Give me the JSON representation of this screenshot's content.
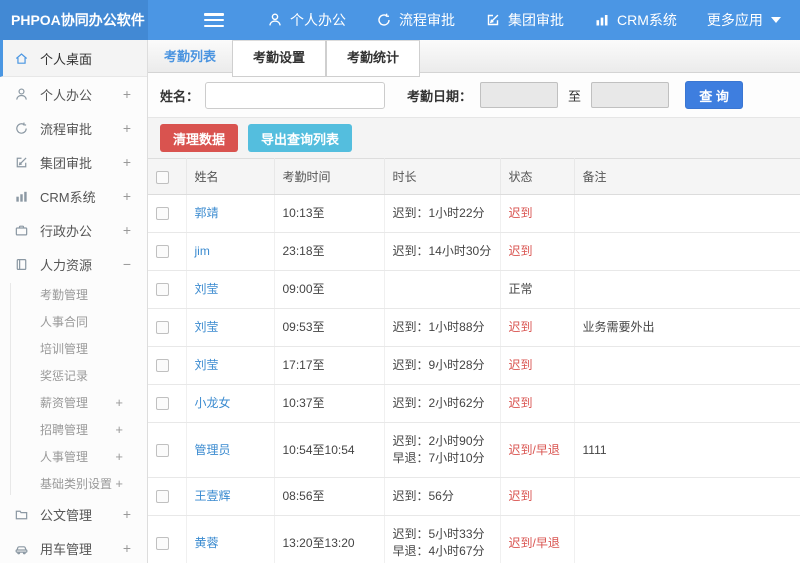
{
  "topbar": {
    "logo": "PHPOA协同办公软件",
    "nav": [
      {
        "label": "个人办公",
        "icon": "user-icon"
      },
      {
        "label": "流程审批",
        "icon": "refresh-icon"
      },
      {
        "label": "集团审批",
        "icon": "edit-icon"
      },
      {
        "label": "CRM系统",
        "icon": "bar-chart-icon"
      },
      {
        "label": "更多应用",
        "icon": "caret-down-icon"
      }
    ]
  },
  "sidebar": {
    "items": [
      {
        "label": "个人桌面",
        "icon": "home-icon",
        "active": true
      },
      {
        "label": "个人办公",
        "icon": "user-icon",
        "expand": "+"
      },
      {
        "label": "流程审批",
        "icon": "refresh-icon",
        "expand": "+"
      },
      {
        "label": "集团审批",
        "icon": "edit-icon",
        "expand": "+"
      },
      {
        "label": "CRM系统",
        "icon": "bar-chart-icon",
        "expand": "+"
      },
      {
        "label": "行政办公",
        "icon": "briefcase-icon",
        "expand": "+"
      },
      {
        "label": "人力资源",
        "icon": "book-icon",
        "expand": "−",
        "expanded": true
      },
      {
        "label": "公文管理",
        "icon": "folder-icon",
        "expand": "+"
      },
      {
        "label": "用车管理",
        "icon": "car-icon",
        "expand": "+"
      }
    ],
    "submenu": [
      {
        "label": "考勤管理"
      },
      {
        "label": "人事合同"
      },
      {
        "label": "培训管理"
      },
      {
        "label": "奖惩记录"
      },
      {
        "label": "薪资管理",
        "expand": "+"
      },
      {
        "label": "招聘管理",
        "expand": "+"
      },
      {
        "label": "人事管理",
        "expand": "+"
      },
      {
        "label": "基础类别设置",
        "expand": "+"
      }
    ]
  },
  "tabs": [
    {
      "label": "考勤列表",
      "active": true
    },
    {
      "label": "考勤设置",
      "active": false
    },
    {
      "label": "考勤统计",
      "active": false
    }
  ],
  "filter": {
    "name_label": "姓名：",
    "name_value": "",
    "date_label": "考勤日期：",
    "date_from_value": "",
    "to_label": "至",
    "date_to_value": "",
    "search_label": "查 询"
  },
  "actions": {
    "clean": "清理数据",
    "export": "导出查询列表"
  },
  "table": {
    "columns": [
      "姓名",
      "考勤时间",
      "时长",
      "状态",
      "备注"
    ],
    "rows": [
      {
        "name": "郭靖",
        "time": "10:13至",
        "duration": "迟到：1小时22分",
        "status": "迟到",
        "note": ""
      },
      {
        "name": "jim",
        "time": "23:18至",
        "duration": "迟到：14小时30分",
        "status": "迟到",
        "note": ""
      },
      {
        "name": "刘莹",
        "time": "09:00至",
        "duration": "",
        "status": "正常",
        "note": ""
      },
      {
        "name": "刘莹",
        "time": "09:53至",
        "duration": "迟到：1小时88分",
        "status": "迟到",
        "note": "业务需要外出"
      },
      {
        "name": "刘莹",
        "time": "17:17至",
        "duration": "迟到：9小时28分",
        "status": "迟到",
        "note": ""
      },
      {
        "name": "小龙女",
        "time": "10:37至",
        "duration": "迟到：2小时62分",
        "status": "迟到",
        "note": ""
      },
      {
        "name": "管理员",
        "time": "10:54至10:54",
        "duration": "迟到：2小时90分",
        "duration2": "早退：7小时10分",
        "status": "迟到/早退",
        "note": "1111"
      },
      {
        "name": "王壹辉",
        "time": "08:56至",
        "duration": "迟到：56分",
        "status": "迟到",
        "note": ""
      },
      {
        "name": "黄蓉",
        "time": "13:20至13:20",
        "duration": "迟到：5小时33分",
        "duration2": "早退：4小时67分",
        "status": "迟到/早退",
        "note": ""
      }
    ]
  },
  "colors": {
    "topbar_bg": "#4b96e4",
    "logo_bg": "#4289d4",
    "accent_blue": "#4a94e0",
    "link_blue": "#3b8bd0",
    "status_red": "#d9534f",
    "search_button_blue": "#3e7edf",
    "clean_button_red": "#d9534f",
    "export_button_cyan": "#54bede"
  }
}
